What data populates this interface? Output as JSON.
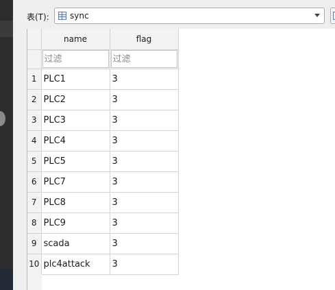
{
  "toolbar": {
    "table_label": "表(T):",
    "table_value": "sync"
  },
  "grid": {
    "columns": [
      {
        "label": "name",
        "filter_placeholder": "过滤"
      },
      {
        "label": "flag",
        "filter_placeholder": "过滤"
      }
    ],
    "rows": [
      {
        "num": "1",
        "name": "PLC1",
        "flag": "3"
      },
      {
        "num": "2",
        "name": "PLC2",
        "flag": "3"
      },
      {
        "num": "3",
        "name": "PLC3",
        "flag": "3"
      },
      {
        "num": "4",
        "name": "PLC4",
        "flag": "3"
      },
      {
        "num": "5",
        "name": "PLC5",
        "flag": "3"
      },
      {
        "num": "6",
        "name": "PLC7",
        "flag": "3"
      },
      {
        "num": "7",
        "name": "PLC8",
        "flag": "3"
      },
      {
        "num": "8",
        "name": "PLC9",
        "flag": "3"
      },
      {
        "num": "9",
        "name": "scada",
        "flag": "3"
      },
      {
        "num": "10",
        "name": "plc4attack",
        "flag": "3"
      }
    ]
  },
  "colors": {
    "header_bg": "#f3f3f3",
    "grid_line": "#d4d4d4",
    "left_panel": "#2d2d2d"
  },
  "icons": {
    "table_icon": "table-icon",
    "dropdown": "chevron-down-icon"
  }
}
